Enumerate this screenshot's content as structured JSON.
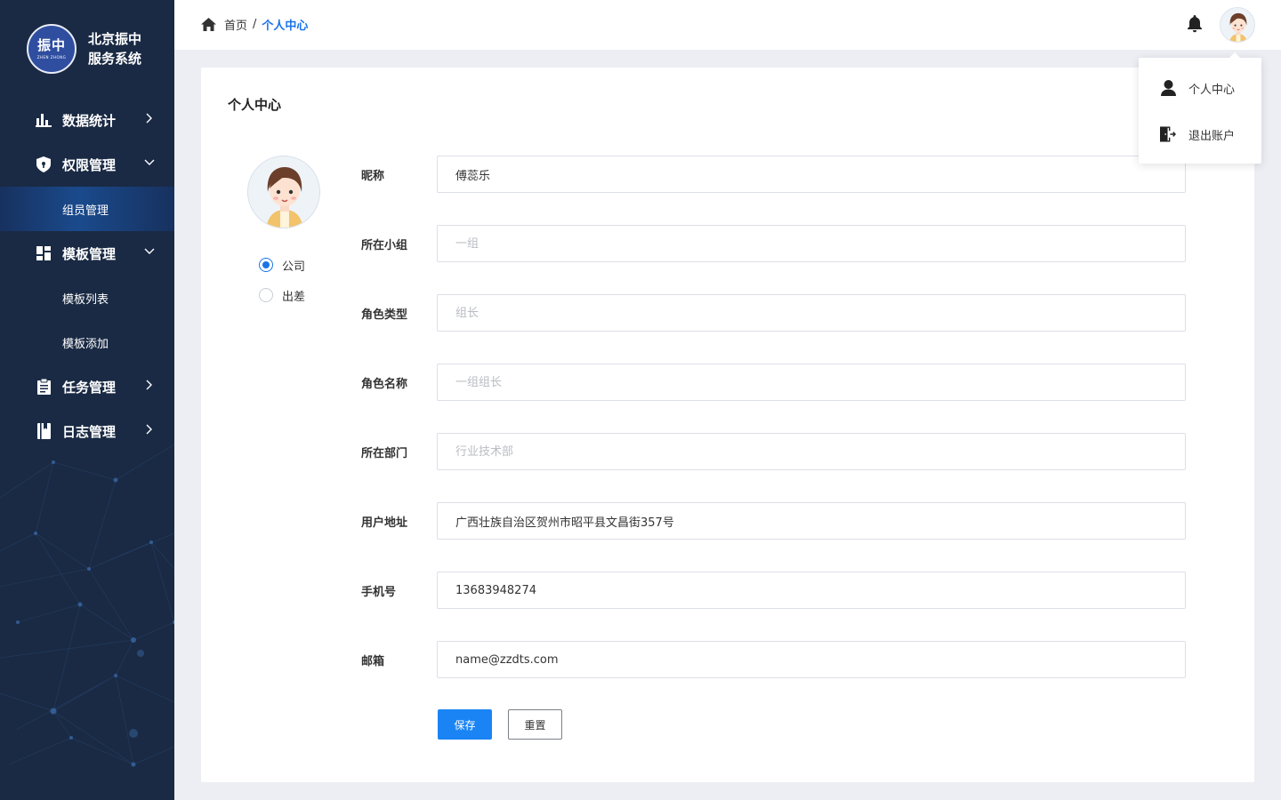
{
  "brand": {
    "logo_text": "振中",
    "logo_subtext": "ZHEN ZHONG",
    "name_line1": "北京振中",
    "name_line2": "服务系统"
  },
  "sidebar": {
    "items": [
      {
        "label": "数据统计",
        "icon": "bar-chart-icon",
        "expanded": false
      },
      {
        "label": "权限管理",
        "icon": "shield-icon",
        "expanded": true,
        "children": [
          "组员管理"
        ]
      },
      {
        "label": "模板管理",
        "icon": "grid-icon",
        "expanded": true,
        "children": [
          "模板列表",
          "模板添加"
        ]
      },
      {
        "label": "任务管理",
        "icon": "clipboard-icon",
        "expanded": false
      },
      {
        "label": "日志管理",
        "icon": "book-icon",
        "expanded": false
      }
    ],
    "active_child": "组员管理"
  },
  "header": {
    "breadcrumb": {
      "home": "首页",
      "separator": "/",
      "current": "个人中心"
    }
  },
  "dropdown": {
    "items": [
      {
        "label": "个人中心",
        "icon": "user-icon"
      },
      {
        "label": "退出账户",
        "icon": "logout-icon"
      }
    ]
  },
  "card": {
    "title": "个人中心",
    "status_options": [
      {
        "label": "公司",
        "checked": true
      },
      {
        "label": "出差",
        "checked": false
      }
    ],
    "fields": [
      {
        "label": "昵称",
        "value": "傅蕊乐",
        "placeholder": ""
      },
      {
        "label": "所在小组",
        "value": "",
        "placeholder": "一组"
      },
      {
        "label": "角色类型",
        "value": "",
        "placeholder": "组长"
      },
      {
        "label": "角色名称",
        "value": "",
        "placeholder": "一组组长"
      },
      {
        "label": "所在部门",
        "value": "",
        "placeholder": "行业技术部"
      },
      {
        "label": "用户地址",
        "value": "广西壮族自治区贺州市昭平县文昌街357号",
        "placeholder": ""
      },
      {
        "label": "手机号",
        "value": "13683948274",
        "placeholder": ""
      },
      {
        "label": "邮箱",
        "value": "name@zzdts.com",
        "placeholder": ""
      }
    ],
    "save_label": "保存",
    "reset_label": "重置"
  },
  "colors": {
    "sidebar_bg": "#1a2a44",
    "accent": "#1a73e8",
    "primary_button": "#1a84f4",
    "page_bg": "#eceef3"
  }
}
